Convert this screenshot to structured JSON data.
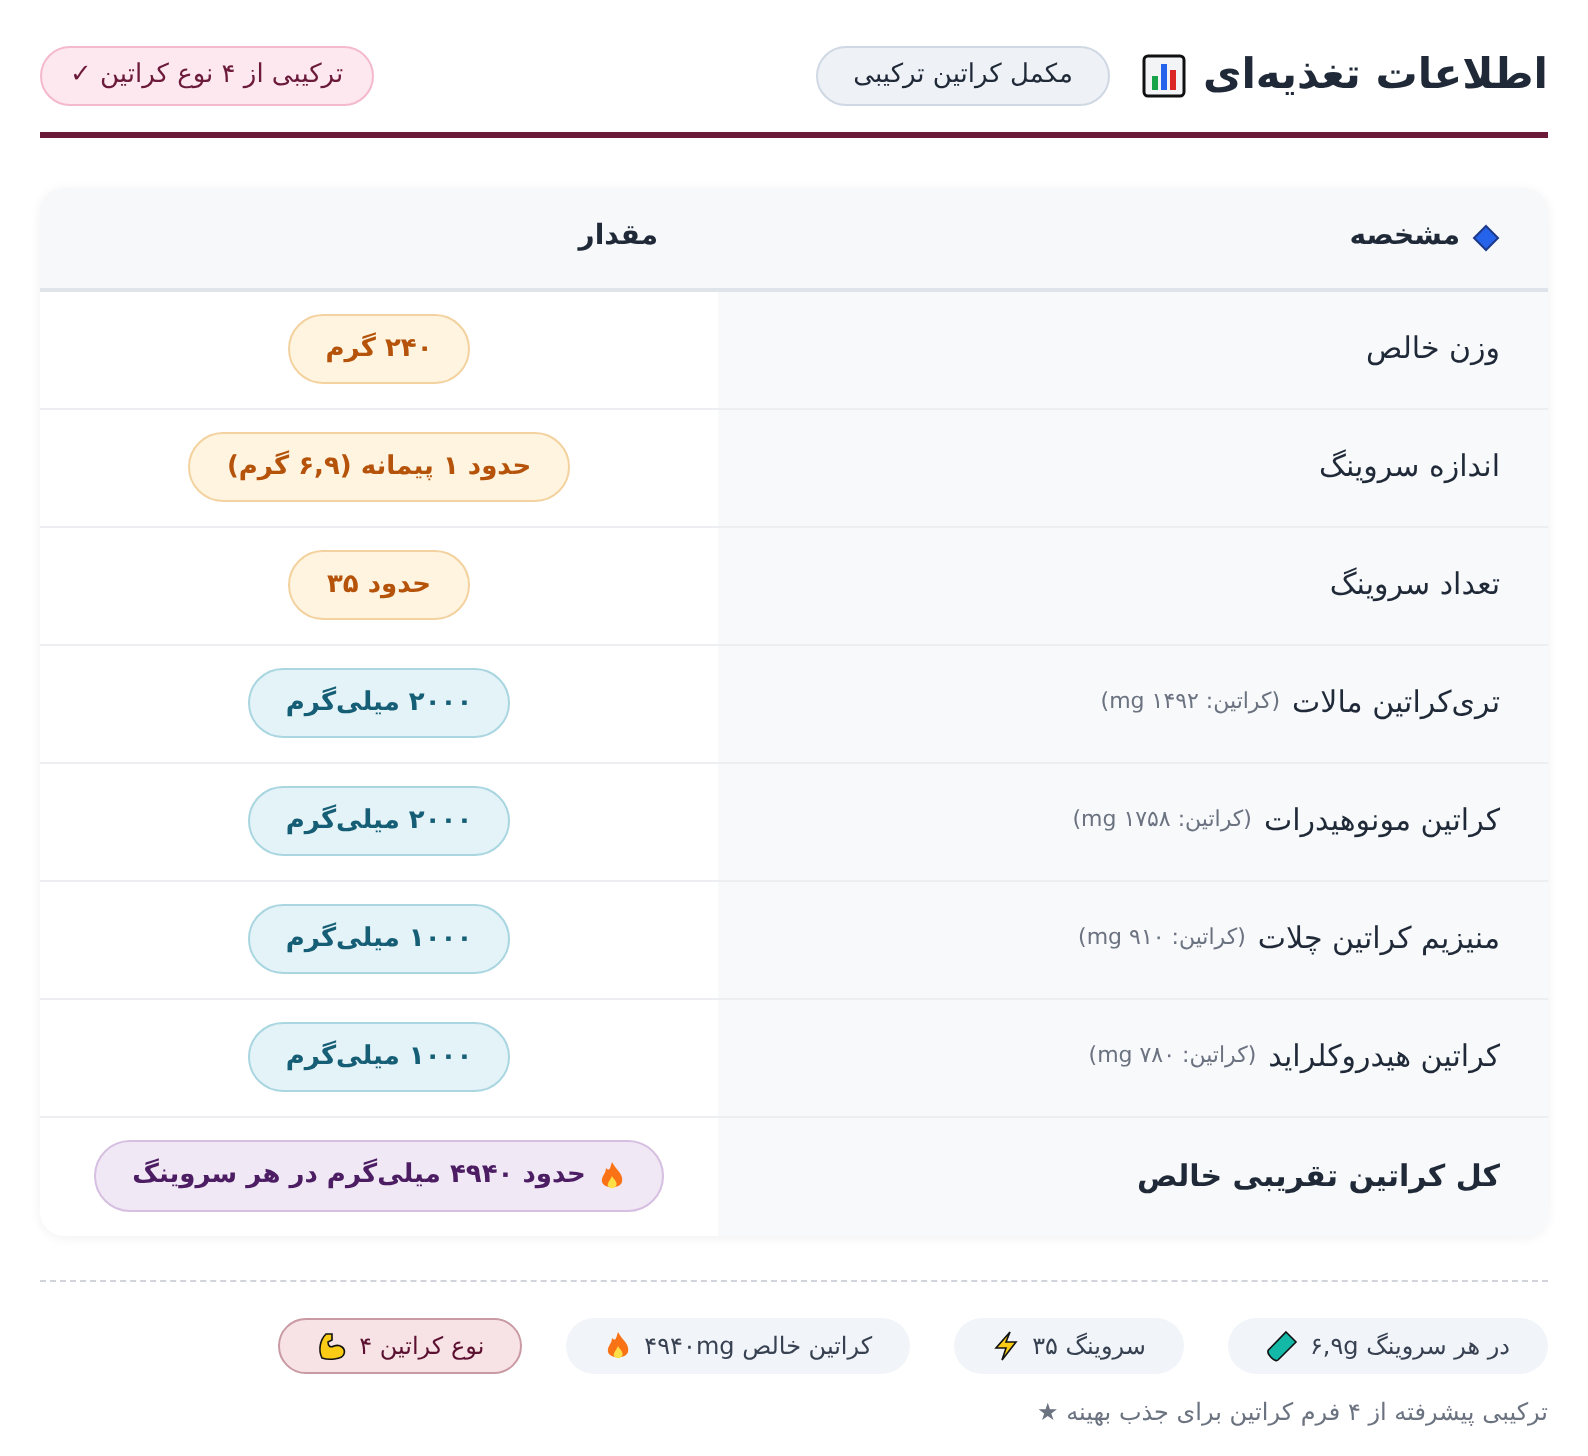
{
  "header": {
    "title": "اطلاعات تغذیه‌ای",
    "tag": "مکمل کراتین ترکیبی",
    "badge": "ترکیبی از ۴ نوع کراتین ✓"
  },
  "table": {
    "columns": [
      "مشخصه",
      "مقدار"
    ],
    "rows": [
      {
        "label": "وزن خالص",
        "value": "۲۴۰ گرم",
        "kind": "amber"
      },
      {
        "label": "اندازه سروینگ",
        "value": "حدود ۱ پیمانه (۶,۹ گرم)",
        "kind": "amber"
      },
      {
        "label": "تعداد سروینگ",
        "value": "حدود ۳۵",
        "kind": "amber"
      },
      {
        "label": "تری‌کراتین مالات",
        "note": "(کراتین: ۱۴۹۲ mg)",
        "value": "۲۰۰۰ میلی‌گرم",
        "kind": "teal"
      },
      {
        "label": "کراتین مونوهیدرات",
        "note": "(کراتین: ۱۷۵۸ mg)",
        "value": "۲۰۰۰ میلی‌گرم",
        "kind": "teal"
      },
      {
        "label": "منیزیم کراتین چلات",
        "note": "(کراتین: ۹۱۰ mg)",
        "value": "۱۰۰۰ میلی‌گرم",
        "kind": "teal"
      },
      {
        "label": "کراتین هیدروکلراید",
        "note": "(کراتین: ۷۸۰ mg)",
        "value": "۱۰۰۰ میلی‌گرم",
        "kind": "teal"
      },
      {
        "label": "کل کراتین تقریبی خالص",
        "value": "حدود ۴۹۴۰ میلی‌گرم در هر سروینگ",
        "kind": "total"
      }
    ]
  },
  "chips": [
    {
      "label": "در هر سروینگ ۶,۹g",
      "kind": "plain"
    },
    {
      "label": "سروینگ ۳۵",
      "kind": "plain"
    },
    {
      "label": "کراتین خالص ۴۹۴۰mg",
      "kind": "plain"
    },
    {
      "label": "نوع کراتین ۴",
      "kind": "highlight"
    }
  ],
  "footnote": "ترکیبی پیشرفته از ۴ فرم کراتین برای جذب بهینه ★"
}
